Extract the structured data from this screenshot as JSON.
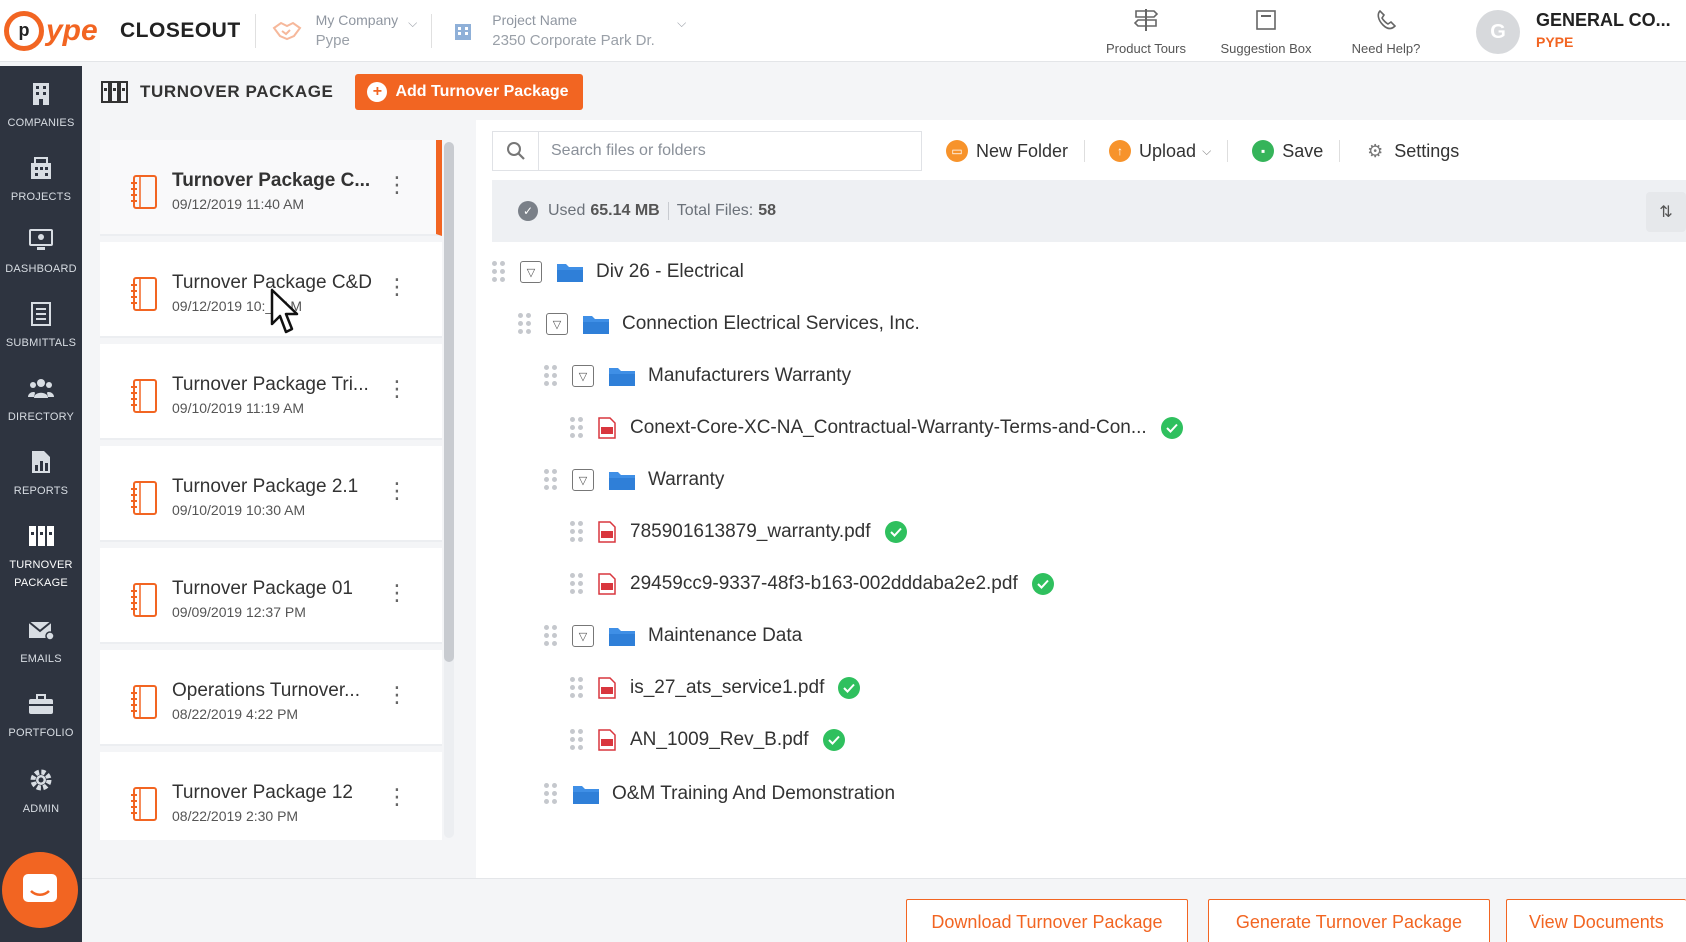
{
  "topbar": {
    "module": "CLOSEOUT",
    "company_label": "My Company",
    "company_value": "Pype",
    "project_label": "Project Name",
    "project_value": "2350 Corporate Park Dr.",
    "tools": [
      {
        "label": "Product Tours",
        "icon": "signpost-icon"
      },
      {
        "label": "Suggestion Box",
        "icon": "suggestion-box-icon"
      },
      {
        "label": "Need Help?",
        "icon": "phone-icon"
      }
    ],
    "user_initial": "G",
    "user_name": "GENERAL CO...",
    "user_org": "PYPE"
  },
  "brand": {
    "logo_text": "ype",
    "accent": "#f26522"
  },
  "nav": [
    {
      "label": "COMPANIES",
      "icon": "building-icon"
    },
    {
      "label": "PROJECTS",
      "icon": "projects-icon"
    },
    {
      "label": "DASHBOARD",
      "icon": "monitor-icon"
    },
    {
      "label": "SUBMITTALS",
      "icon": "document-list-icon"
    },
    {
      "label": "DIRECTORY",
      "icon": "people-icon"
    },
    {
      "label": "REPORTS",
      "icon": "report-chart-icon"
    },
    {
      "label": "TURNOVER PACKAGE",
      "icon": "binder-icon",
      "active": true
    },
    {
      "label": "EMAILS",
      "icon": "email-icon"
    },
    {
      "label": "PORTFOLIO",
      "icon": "briefcase-icon"
    },
    {
      "label": "ADMIN",
      "icon": "gear-icon"
    }
  ],
  "header": {
    "title": "TURNOVER PACKAGE",
    "add_label": "Add Turnover Package"
  },
  "packages": [
    {
      "name": "Turnover Package C...",
      "date": "09/12/2019 11:40 AM",
      "active": true
    },
    {
      "name": "Turnover Package C&D",
      "date": "09/12/2019 10:__AM"
    },
    {
      "name": "Turnover Package Tri...",
      "date": "09/10/2019 11:19 AM"
    },
    {
      "name": "Turnover Package 2.1",
      "date": "09/10/2019 10:30 AM"
    },
    {
      "name": "Turnover Package 01",
      "date": "09/09/2019 12:37 PM"
    },
    {
      "name": "Operations Turnover...",
      "date": "08/22/2019 4:22 PM"
    },
    {
      "name": "Turnover Package 12",
      "date": "08/22/2019 2:30 PM"
    }
  ],
  "toolbar": {
    "search_placeholder": "Search files or folders",
    "new_folder": "New Folder",
    "upload": "Upload",
    "save": "Save",
    "settings": "Settings"
  },
  "usage": {
    "used_label": "Used",
    "used_value": "65.14 MB",
    "total_label": "Total Files:",
    "total_value": "58"
  },
  "tree": [
    {
      "type": "folder",
      "label": "Div 26 - Electrical",
      "level": 0,
      "expanded": true
    },
    {
      "type": "folder",
      "label": "Connection Electrical Services, Inc.",
      "level": 1,
      "expanded": true
    },
    {
      "type": "folder",
      "label": "Manufacturers Warranty",
      "level": 2,
      "expanded": true
    },
    {
      "type": "file",
      "label": "Conext-Core-XC-NA_Contractual-Warranty-Terms-and-Con...",
      "level": 3,
      "verified": true
    },
    {
      "type": "folder",
      "label": "Warranty",
      "level": 2,
      "expanded": true
    },
    {
      "type": "file",
      "label": "785901613879_warranty.pdf",
      "level": 3,
      "verified": true
    },
    {
      "type": "file",
      "label": "29459cc9-9337-48f3-b163-002dddaba2e2.pdf",
      "level": 3,
      "verified": true
    },
    {
      "type": "folder",
      "label": "Maintenance Data",
      "level": 2,
      "expanded": true
    },
    {
      "type": "file",
      "label": "is_27_ats_service1.pdf",
      "level": 3,
      "verified": true
    },
    {
      "type": "file",
      "label": "AN_1009_Rev_B.pdf",
      "level": 3,
      "verified": true
    },
    {
      "type": "folder",
      "label": "O&M Training And Demonstration",
      "level": 2,
      "expanded": false
    }
  ],
  "bottom": {
    "download": "Download Turnover Package",
    "generate": "Generate Turnover Package",
    "view": "View Documents"
  }
}
